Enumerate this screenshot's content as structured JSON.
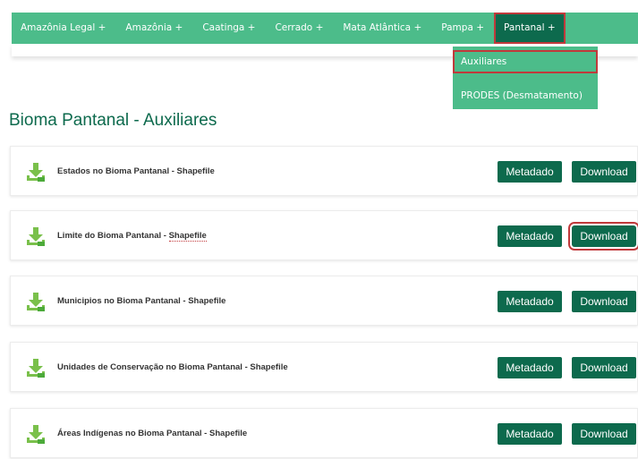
{
  "nav": {
    "items": [
      {
        "label": "Amazônia Legal +"
      },
      {
        "label": "Amazônia +"
      },
      {
        "label": "Caatinga +"
      },
      {
        "label": "Cerrado +"
      },
      {
        "label": "Mata Atlântica +"
      },
      {
        "label": "Pampa +"
      },
      {
        "label": "Pantanal +"
      }
    ],
    "active_index": 6
  },
  "dropdown": {
    "items": [
      {
        "label": "Auxiliares"
      },
      {
        "label": "PRODES (Desmatamento)"
      }
    ]
  },
  "page": {
    "title": "Bioma Pantanal - Auxiliares"
  },
  "cards": [
    {
      "label": "Estados no Bioma Pantanal - Shapefile",
      "metadata_label": "Metadado",
      "download_label": "Download"
    },
    {
      "label_prefix": "Limite do Bioma Pantanal - ",
      "label_underlined": "Shapefile",
      "metadata_label": "Metadado",
      "download_label": "Download"
    },
    {
      "label": "Municipios no Bioma Pantanal - Shapefile",
      "metadata_label": "Metadado",
      "download_label": "Download"
    },
    {
      "label": "Unidades de Conservação no Bioma Pantanal - Shapefile",
      "metadata_label": "Metadado",
      "download_label": "Download"
    },
    {
      "label": "Áreas Indígenas no Bioma Pantanal - Shapefile",
      "metadata_label": "Metadado",
      "download_label": "Download"
    }
  ],
  "icons": {
    "download": "download-icon"
  },
  "colors": {
    "nav": "#4cbc8a",
    "primary": "#0d6a4d",
    "highlight": "#c0393b",
    "icon": "#7ac04b"
  }
}
